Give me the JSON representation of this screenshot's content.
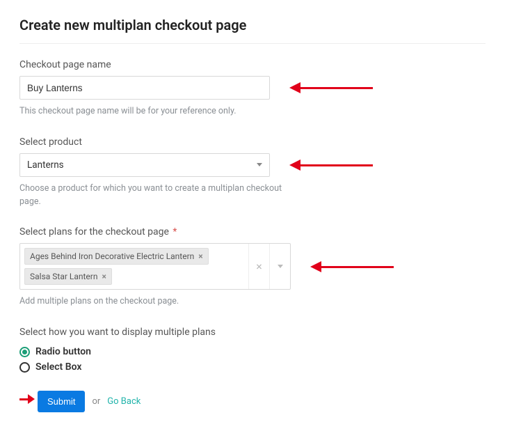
{
  "title": "Create new multiplan checkout page",
  "name_field": {
    "label": "Checkout page name",
    "value": "Buy Lanterns",
    "helper": "This checkout page name will be for your reference only."
  },
  "product_field": {
    "label": "Select product",
    "value": "Lanterns",
    "helper": "Choose a product for which you want to create a multiplan checkout page."
  },
  "plans_field": {
    "label": "Select plans for the checkout page",
    "required_mark": "*",
    "selected": [
      "Ages Behind Iron Decorative Electric Lantern",
      "Salsa Star Lantern"
    ],
    "helper": "Add multiple plans on the checkout page."
  },
  "display_field": {
    "label": "Select how you want to display multiple plans",
    "options": [
      "Radio button",
      "Select Box"
    ],
    "selected_index": 0
  },
  "actions": {
    "submit": "Submit",
    "or": "or",
    "go_back": "Go Back"
  }
}
